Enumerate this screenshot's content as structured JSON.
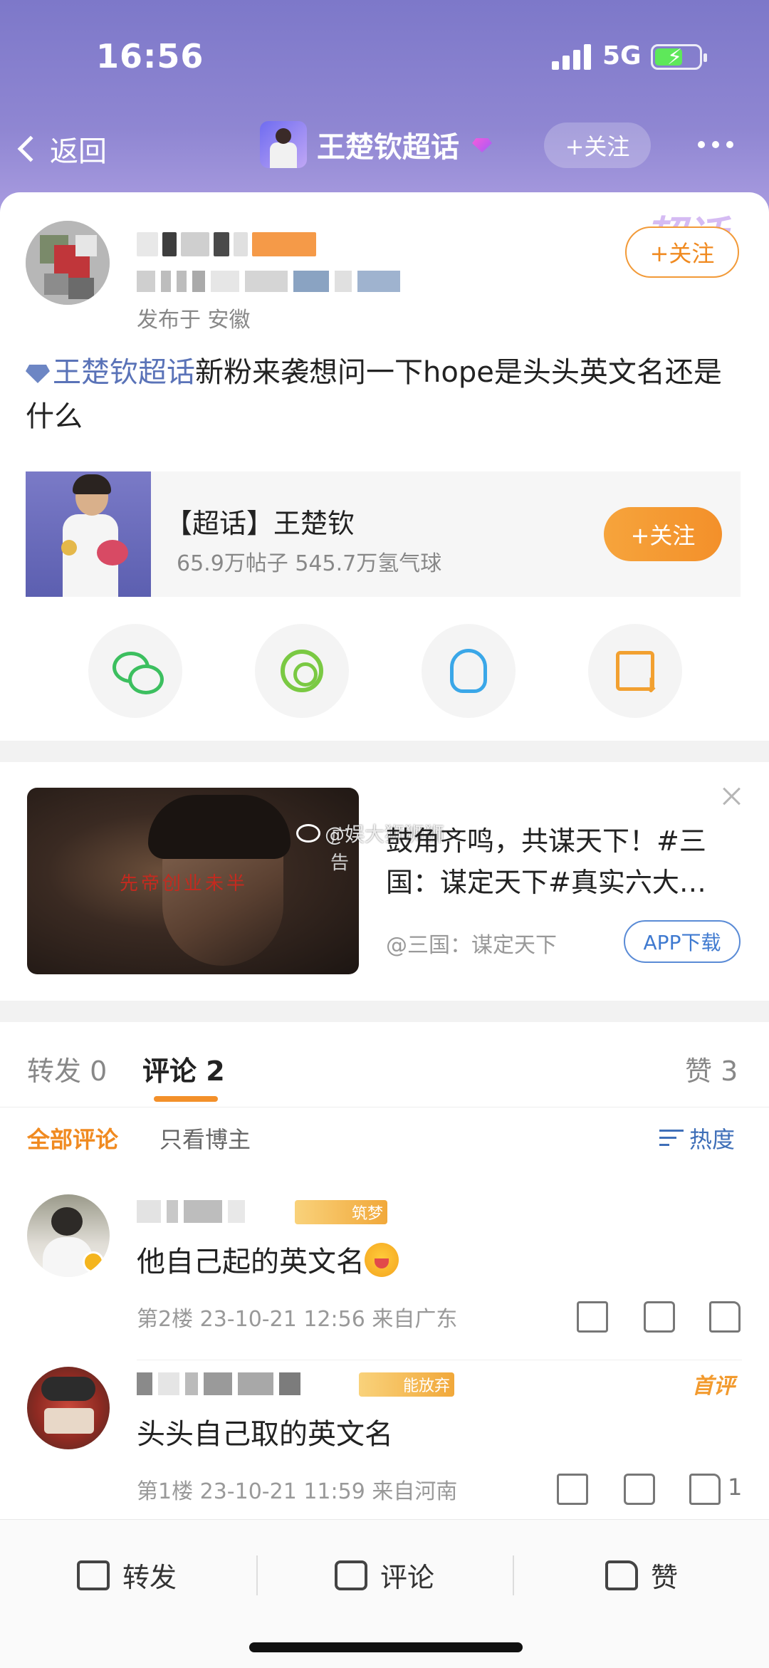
{
  "status_bar": {
    "time": "16:56",
    "network": "5G"
  },
  "nav": {
    "back_label": "返回",
    "title": "王楚钦超话",
    "follow_label": "+关注"
  },
  "post": {
    "location": "发布于 安徽",
    "follow_label": "+关注",
    "topic_tag": "王楚钦超话",
    "text": "新粉来袭想问一下hope是头头英文名还是什么",
    "supertopic_deco": "超话"
  },
  "supertopic_card": {
    "title": "【超话】王楚钦",
    "stats": "65.9万帖子 545.7万氢气球",
    "follow_label": "+关注"
  },
  "share_buttons": [
    {
      "name": "wechat-icon"
    },
    {
      "name": "moments-icon"
    },
    {
      "name": "qq-icon"
    },
    {
      "name": "save-image-icon"
    }
  ],
  "ad": {
    "badge": "广告",
    "image_text": "先帝创业未半",
    "watermark": "@娱大狮狮狮",
    "title": "鼓角齐鸣，共谋天下！#三国：谋定天下#真实六大…",
    "source": "@三国：谋定天下",
    "download_label": "APP下载"
  },
  "tabs": {
    "repost": {
      "label": "转发",
      "count": "0"
    },
    "comments": {
      "label": "评论",
      "count": "2"
    },
    "likes": {
      "label": "赞",
      "count": "3"
    }
  },
  "filters": {
    "all": "全部评论",
    "owner_only": "只看博主",
    "sort": "热度"
  },
  "comments": [
    {
      "badge": "筑梦",
      "text": "他自己起的英文名",
      "meta": "第2楼 23-10-21 12:56 来自广东",
      "likes": ""
    },
    {
      "badge": "能放弃",
      "text": "头头自己取的英文名",
      "meta": "第1楼 23-10-21 11:59 来自河南",
      "likes": "1",
      "first_tag": "首评"
    }
  ],
  "bottom_bar": {
    "repost": "转发",
    "comment": "评论",
    "like": "赞"
  },
  "colors": {
    "accent_orange": "#f3902a",
    "link_blue": "#5a73b8",
    "header_purple": "#8f86d2"
  }
}
